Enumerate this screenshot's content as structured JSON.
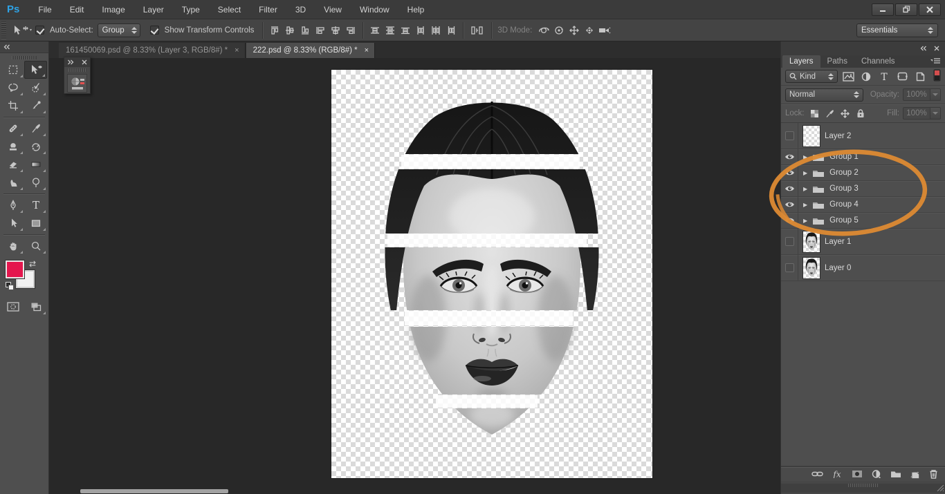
{
  "window": {
    "controls": [
      "minimize",
      "restore",
      "close"
    ]
  },
  "menu_bar": {
    "logo": "Ps",
    "items": [
      "File",
      "Edit",
      "Image",
      "Layer",
      "Type",
      "Select",
      "Filter",
      "3D",
      "View",
      "Window",
      "Help"
    ]
  },
  "options_bar": {
    "tool_icon": "move-tool",
    "auto_select": {
      "label": "Auto-Select:",
      "checked": true
    },
    "target_dropdown": {
      "value": "Group"
    },
    "show_transform": {
      "label": "Show Transform Controls",
      "checked": true
    },
    "align_icons": [
      "align-top-edges",
      "align-vertical-centers",
      "align-bottom-edges",
      "align-left-edges",
      "align-horizontal-centers",
      "align-right-edges",
      "distribute-top-edges",
      "distribute-vertical-centers",
      "distribute-bottom-edges",
      "distribute-left-edges",
      "distribute-horizontal-centers",
      "distribute-right-edges",
      "distribute-spacing"
    ],
    "mode_label": "3D Mode:",
    "mode_icons": [
      "orbit-3d-camera",
      "roll-3d-camera",
      "pan-3d-camera",
      "slide-3d-camera",
      "move-3d-camera"
    ],
    "workspace_dropdown": {
      "value": "Essentials"
    }
  },
  "document_tabs": [
    {
      "label": "161450069.psd @ 8.33% (Layer 3, RGB/8#) *",
      "close": "×",
      "active": false
    },
    {
      "label": "222.psd @ 8.33% (RGB/8#) *",
      "close": "×",
      "active": true
    }
  ],
  "toolbar": {
    "tools": [
      "rectangular-marquee",
      "move",
      "lasso",
      "quick-selection",
      "crop",
      "eyedropper",
      "spot-healing-brush",
      "brush",
      "clone-stamp",
      "history-brush",
      "eraser",
      "gradient",
      "smudge",
      "dodge",
      "pen",
      "horizontal-type",
      "path-selection",
      "rectangle-shape",
      "hand",
      "zoom",
      "quick-mask",
      "screen-mode"
    ],
    "selected_tool": "move",
    "foreground_color": "#e4174e",
    "background_color": "#f1f1f1"
  },
  "layers_panel": {
    "tabs": [
      {
        "label": "Layers",
        "active": true
      },
      {
        "label": "Paths",
        "active": false
      },
      {
        "label": "Channels",
        "active": false
      }
    ],
    "filter": {
      "kind_value": "Kind",
      "type_icons": [
        "pixel-layer-filter",
        "adjustment-layer-filter",
        "type-layer-filter",
        "shape-layer-filter",
        "smart-object-filter",
        "filtering-toggle"
      ]
    },
    "blend_mode": {
      "value": "Normal"
    },
    "opacity": {
      "label": "Opacity:",
      "value": "100%"
    },
    "lock": {
      "label": "Lock:",
      "icons": [
        "lock-transparent-pixels",
        "lock-image-pixels",
        "lock-position",
        "lock-all"
      ]
    },
    "fill": {
      "label": "Fill:",
      "value": "100%"
    },
    "layers": [
      {
        "name": "Layer 2",
        "type": "layer",
        "visible": false,
        "thumb": "transparent"
      },
      {
        "name": "Group 1",
        "type": "group",
        "visible": true
      },
      {
        "name": "Group 2",
        "type": "group",
        "visible": true
      },
      {
        "name": "Group 3",
        "type": "group",
        "visible": true
      },
      {
        "name": "Group 4",
        "type": "group",
        "visible": true
      },
      {
        "name": "Group 5",
        "type": "group",
        "visible": true
      },
      {
        "name": "Layer 1",
        "type": "layer",
        "visible": false,
        "thumb": "face"
      },
      {
        "name": "Layer 0",
        "type": "layer",
        "visible": false,
        "thumb": "face"
      }
    ],
    "bottom_icons": [
      "link-layers",
      "layer-effects",
      "add-layer-mask",
      "new-adjustment-layer",
      "new-group",
      "new-layer",
      "delete-layer"
    ],
    "fx_glyph": "fx"
  },
  "canvas": {
    "content": "grayscale woman face sliced into 5 horizontal bands on transparency",
    "slice_count": 5
  },
  "annotation": {
    "shape": "hand-drawn ellipse around Group 1-5",
    "color": "#dd8a33"
  },
  "colors": {
    "ui_background": "#474747",
    "pasteboard": "#282828",
    "accent_orange": "#dd8a33",
    "foreground_swatch": "#e4174e"
  }
}
